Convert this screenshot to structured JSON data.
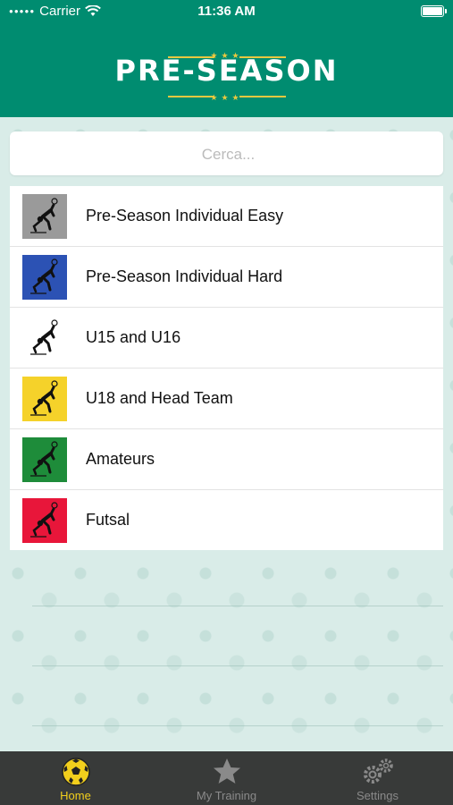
{
  "status_bar": {
    "carrier": "Carrier",
    "time": "11:36 AM"
  },
  "header": {
    "logo_text": "PRE-SEASON",
    "logo_stars": "★★★",
    "background_color": "#008c70",
    "accent_color": "#e8c840"
  },
  "search": {
    "placeholder": "Cerca..."
  },
  "programs": [
    {
      "label": "Pre-Season Individual Easy",
      "thumb_color": "#9a9a9a"
    },
    {
      "label": "Pre-Season Individual Hard",
      "thumb_color": "#2c52b4"
    },
    {
      "label": "U15 and U16",
      "thumb_color": "#ffffff"
    },
    {
      "label": "U18 and Head Team",
      "thumb_color": "#f5d22a"
    },
    {
      "label": "Amateurs",
      "thumb_color": "#1e8c3a"
    },
    {
      "label": "Futsal",
      "thumb_color": "#e8163a"
    }
  ],
  "tabbar": {
    "tabs": [
      {
        "label": "Home",
        "icon": "soccer-ball-icon",
        "active": true,
        "color": "#f2cf1c"
      },
      {
        "label": "My Training",
        "icon": "star-icon",
        "active": false,
        "color": "#8a8a8a"
      },
      {
        "label": "Settings",
        "icon": "gears-icon",
        "active": false,
        "color": "#8a8a8a"
      }
    ]
  }
}
